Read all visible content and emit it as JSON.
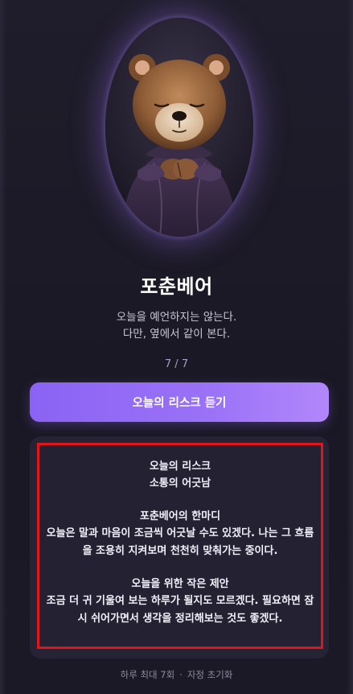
{
  "character": {
    "name": "포춘베어",
    "tagline_line1": "오늘을 예언하지는 않는다.",
    "tagline_line2": "다만, 옆에서 같이 본다.",
    "image_icon": "bear-portrait"
  },
  "counter": "7 / 7",
  "cta_label": "오늘의 리스크 듣기",
  "result": {
    "risk_heading": "오늘의 리스크",
    "risk_value": "소통의 어긋남",
    "comment_heading": "포춘베어의 한마디",
    "comment_text": "오늘은 말과 마음이 조금씩 어긋날 수도 있겠다. 나는 그 흐름을 조용히 지켜보며 천천히 맞춰가는 중이다.",
    "tip_heading": "오늘을 위한 작은 제안",
    "tip_text": "조금 더 귀 기울여 보는 하루가 될지도 모르겠다. 필요하면 잠시 쉬어가면서 생각을 정리해보는 것도 좋겠다."
  },
  "footer": {
    "limit_text": "하루 최대 7회",
    "reset_text": "자정 초기화",
    "separator": "·"
  },
  "colors": {
    "background": "#1c1a27",
    "accent_start": "#8a63f4",
    "accent_end": "#b287fb",
    "highlight_border": "#e0141b"
  }
}
